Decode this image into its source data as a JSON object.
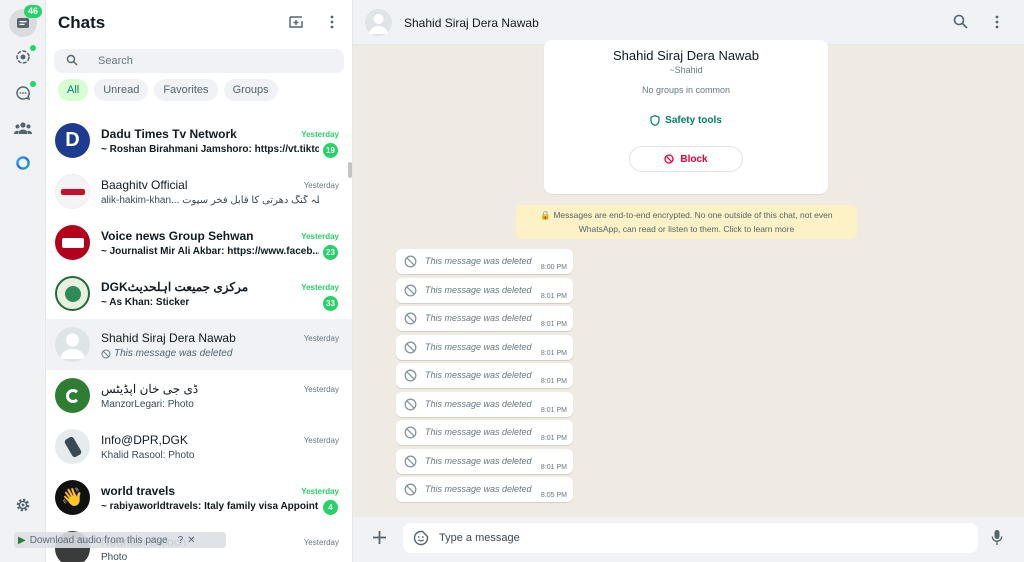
{
  "rail": {
    "chats_badge": "46",
    "items": [
      "chats-icon",
      "status-icon",
      "channels-icon",
      "communities-icon",
      "meta-ai-icon",
      "settings-icon"
    ]
  },
  "sidebar": {
    "title": "Chats",
    "search_placeholder": "Search",
    "filters": [
      "All",
      "Unread",
      "Favorites",
      "Groups"
    ],
    "chats": [
      {
        "name": "Dadu Times Tv Network",
        "message": "~ Roshan Birahmani Jamshoro: https://vt.tikto...",
        "time": "Yesterday",
        "unread": "19"
      },
      {
        "name": "Baaghitv Official",
        "message": "alik-hakim-khan... تلہ گنگ دھرتی کا قابل فخر سپوت",
        "time": "Yesterday",
        "unread": ""
      },
      {
        "name": "Voice news Group Sehwan",
        "message": "~ Journalist Mir Ali Akbar: https://www.faceb...",
        "time": "Yesterday",
        "unread": "23"
      },
      {
        "name": "DGKمرکزی جمیعت اہلحدیث",
        "message": "~ As Khan: Sticker",
        "time": "Yesterday",
        "unread": "33"
      },
      {
        "name": "Shahid Siraj Dera Nawab",
        "message": "This message was deleted",
        "time": "Yesterday",
        "unread": ""
      },
      {
        "name": "ڈی جی خان اپڈیٹس",
        "message": "ManzorLegari: Photo",
        "time": "Yesterday",
        "unread": ""
      },
      {
        "name": "Info@DPR,DGK",
        "message": "Khalid Rasool: Photo",
        "time": "Yesterday",
        "unread": ""
      },
      {
        "name": "world travels",
        "message": "~ rabiyaworldtravels: Italy family visa Appoint...",
        "time": "Yesterday",
        "unread": "4"
      },
      {
        "name": "Nouman Baloch",
        "message": "Photo",
        "time": "Yesterday",
        "unread": ""
      }
    ],
    "download_bar": "Download audio from this page"
  },
  "conversation": {
    "title": "Shahid Siraj Dera Nawab",
    "info": {
      "name": "Shahid Siraj Dera Nawab",
      "subtitle": "~Shahid",
      "groups": "No groups in common",
      "safety": "Safety tools",
      "block": "Block"
    },
    "encryption_line1": "Messages are end-to-end encrypted. No one outside of this chat, not even",
    "encryption_line2": "WhatsApp, can read or listen to them. Click to learn more",
    "messages": [
      {
        "text": "This message was deleted",
        "time": "8:00 PM"
      },
      {
        "text": "This message was deleted",
        "time": "8:01 PM"
      },
      {
        "text": "This message was deleted",
        "time": "8:01 PM"
      },
      {
        "text": "This message was deleted",
        "time": "8:01 PM"
      },
      {
        "text": "This message was deleted",
        "time": "8:01 PM"
      },
      {
        "text": "This message was deleted",
        "time": "8:01 PM"
      },
      {
        "text": "This message was deleted",
        "time": "8:01 PM"
      },
      {
        "text": "This message was deleted",
        "time": "8:01 PM"
      },
      {
        "text": "This message was deleted",
        "time": "8:05 PM"
      }
    ],
    "composer_placeholder": "Type a message"
  },
  "colors": {
    "accent": "#25d366",
    "brand_green": "#008069",
    "danger": "#ea0038",
    "chat_bg": "#efeae2"
  }
}
